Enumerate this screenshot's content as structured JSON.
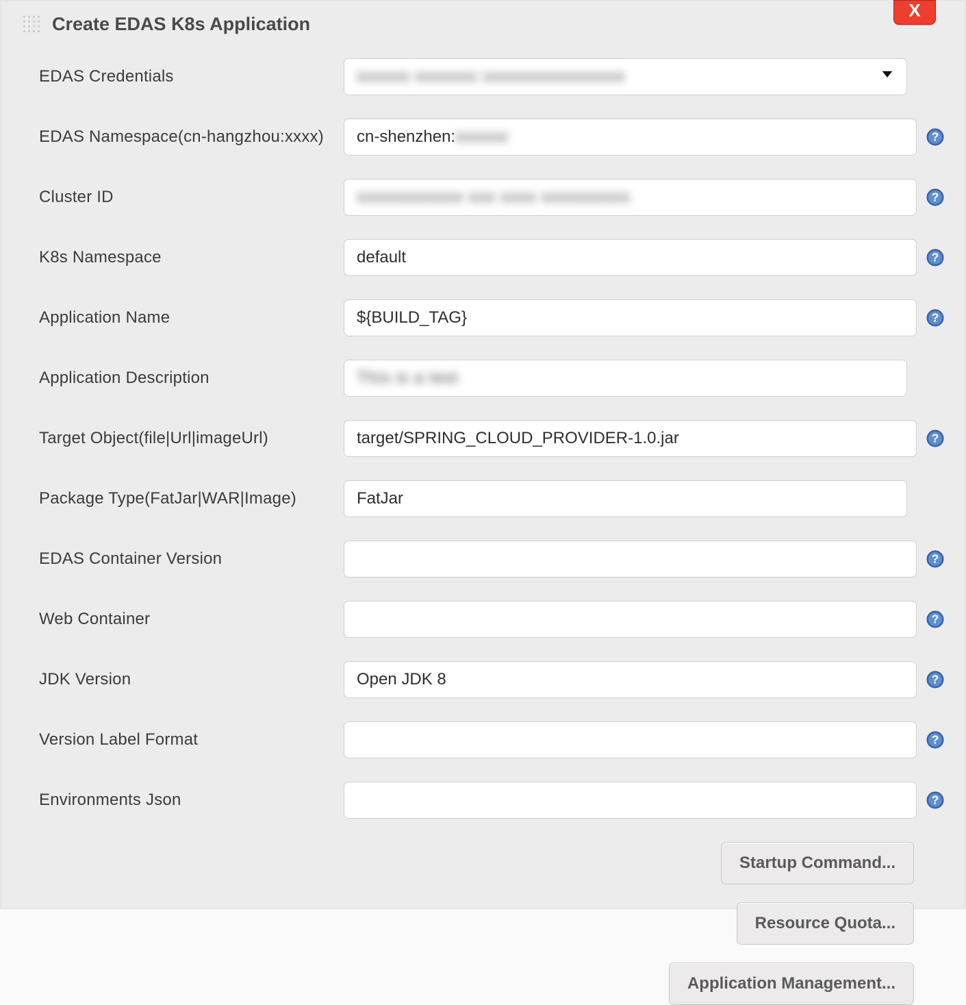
{
  "header": {
    "title": "Create EDAS K8s Application",
    "close_label": "X"
  },
  "fields": {
    "credentials": {
      "label": "EDAS Credentials",
      "value_display": "xxxxxx  xxxxxxx xxxxxxxxxxxxxxxx"
    },
    "namespace": {
      "label": "EDAS Namespace(cn-hangzhou:xxxx)",
      "value_prefix": "cn-shenzhen:",
      "value_hidden": "xxxxxx"
    },
    "cluster_id": {
      "label": "Cluster ID",
      "value_hidden": "xxxxxxxxxxxx xxx xxxx xxxxxxxxxx"
    },
    "k8s_namespace": {
      "label": "K8s Namespace",
      "value": "default"
    },
    "app_name": {
      "label": "Application Name",
      "value": "${BUILD_TAG}"
    },
    "app_desc": {
      "label": "Application Description",
      "value_hidden": "This is a test"
    },
    "target_object": {
      "label": "Target Object(file|Url|imageUrl)",
      "value": "target/SPRING_CLOUD_PROVIDER-1.0.jar"
    },
    "package_type": {
      "label": "Package Type(FatJar|WAR|Image)",
      "value": "FatJar"
    },
    "container_version": {
      "label": "EDAS Container Version",
      "value": ""
    },
    "web_container": {
      "label": "Web Container",
      "value": ""
    },
    "jdk_version": {
      "label": "JDK Version",
      "value": "Open JDK 8"
    },
    "version_label_format": {
      "label": "Version Label Format",
      "value": ""
    },
    "env_json": {
      "label": "Environments Json",
      "value": ""
    }
  },
  "buttons": {
    "startup": "Startup Command...",
    "quota": "Resource Quota...",
    "app_mgmt": "Application Management..."
  }
}
